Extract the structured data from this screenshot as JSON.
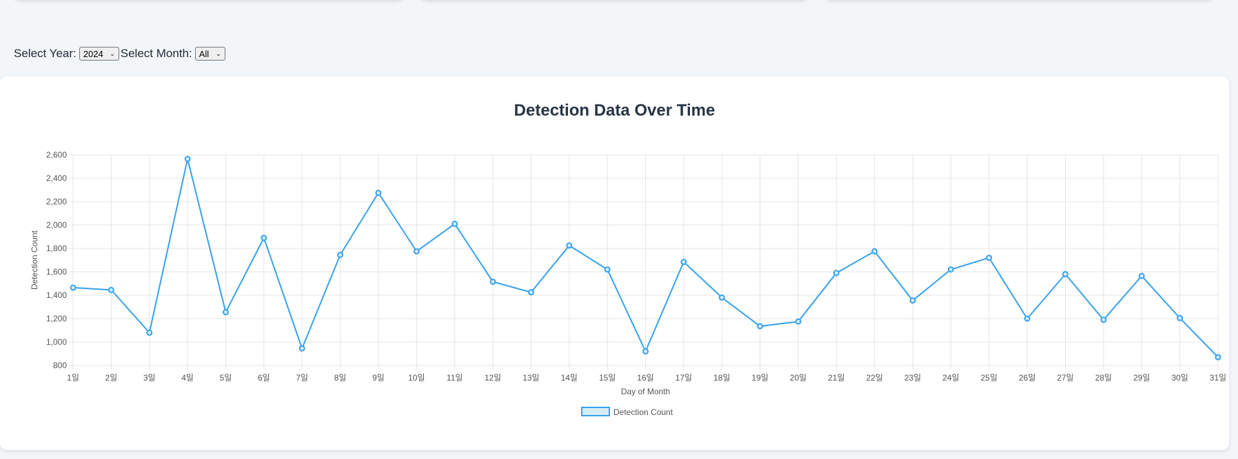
{
  "filters": {
    "year_label": "Select Year:",
    "year_value": "2024",
    "month_label": "Select Month:",
    "month_value": "All"
  },
  "colors": {
    "line": "#36a2eb",
    "legend_fill": "#d7ecfb",
    "grid": "#e5e5e5"
  },
  "chart_data": {
    "type": "line",
    "title": "Detection Data Over Time",
    "xlabel": "Day of Month",
    "ylabel": "Detection Count",
    "categories": [
      "1일",
      "2일",
      "3일",
      "4일",
      "5일",
      "6일",
      "7일",
      "8일",
      "9일",
      "10일",
      "11일",
      "12일",
      "13일",
      "14일",
      "15일",
      "16일",
      "17일",
      "18일",
      "19일",
      "20일",
      "21일",
      "22일",
      "23일",
      "24일",
      "25일",
      "26일",
      "27일",
      "28일",
      "29일",
      "30일",
      "31일"
    ],
    "yticks": [
      "800",
      "1,000",
      "1,200",
      "1,400",
      "1,600",
      "1,800",
      "2,000",
      "2,200",
      "2,400",
      "2,600"
    ],
    "ylim": [
      800,
      2600
    ],
    "grid": true,
    "legend_position": "bottom",
    "series": [
      {
        "name": "Detection Count",
        "values": [
          1465,
          1445,
          1080,
          2565,
          1255,
          1890,
          945,
          1745,
          2275,
          1775,
          2010,
          1515,
          1425,
          1825,
          1620,
          920,
          1685,
          1380,
          1135,
          1175,
          1590,
          1775,
          1355,
          1620,
          1720,
          1200,
          1580,
          1190,
          1565,
          1205,
          870
        ]
      }
    ]
  }
}
